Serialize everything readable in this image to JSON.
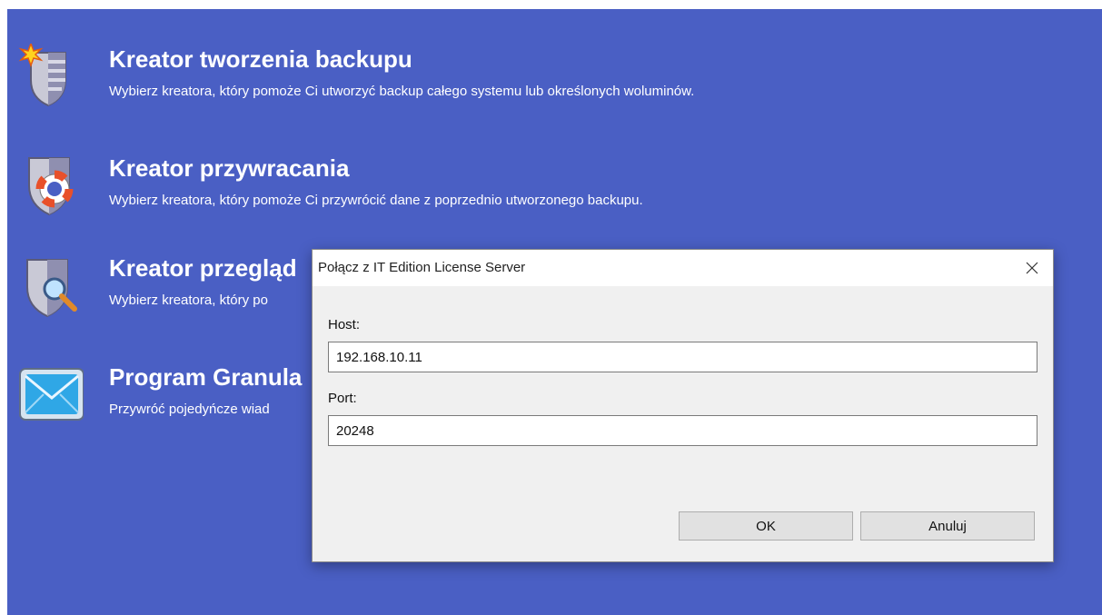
{
  "wizards": [
    {
      "title": "Kreator tworzenia backupu",
      "desc": "Wybierz kreatora, który pomoże Ci utworzyć backup całego systemu lub określonych woluminów.",
      "icon": "shield-star-icon"
    },
    {
      "title": "Kreator przywracania",
      "desc": "Wybierz kreatora, który pomoże Ci przywrócić dane z poprzednio utworzonego backupu.",
      "icon": "shield-lifebuoy-icon"
    },
    {
      "title": "Kreator przegląd",
      "desc": "Wybierz kreatora, który po",
      "icon": "shield-magnifier-icon"
    },
    {
      "title": "Program Granula",
      "desc": "Przywróć pojedyńcze wiad",
      "icon": "envelope-icon"
    }
  ],
  "dialog": {
    "title": "Połącz z IT Edition License Server",
    "host_label": "Host:",
    "host_value": "192.168.10.11",
    "port_label": "Port:",
    "port_value": "20248",
    "ok_label": "OK",
    "cancel_label": "Anuluj"
  },
  "colors": {
    "background": "#4a5fc4",
    "dialog_bg": "#f0f0f0"
  }
}
